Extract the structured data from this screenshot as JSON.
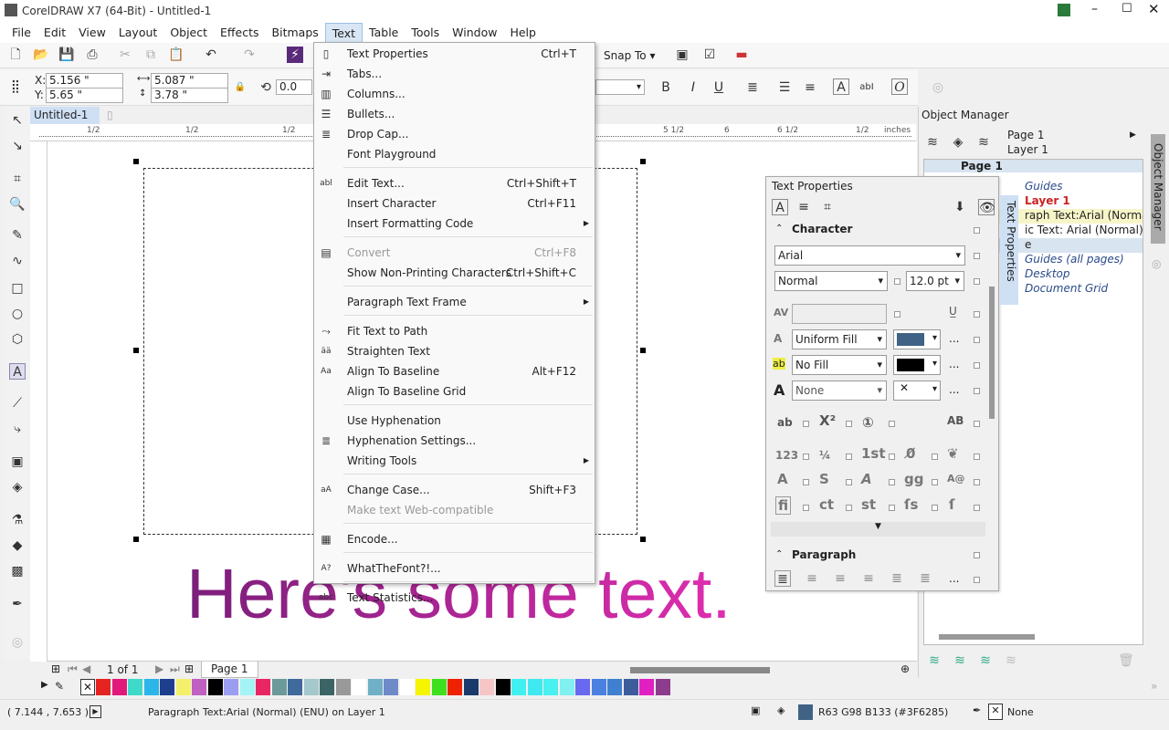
{
  "title": "CorelDRAW X7 (64-Bit) - Untitled-1",
  "menu": [
    "File",
    "Edit",
    "View",
    "Layout",
    "Object",
    "Effects",
    "Bitmaps",
    "Text",
    "Table",
    "Tools",
    "Window",
    "Help"
  ],
  "menu_active": "Text",
  "toolbar": {
    "snap_to": "Snap To"
  },
  "propbar": {
    "x": "5.156 \"",
    "y": "5.65 \"",
    "x_label": "X:",
    "y_label": "Y:",
    "width": "5.087 \"",
    "height": "3.78 \"",
    "rotation": "0.0"
  },
  "document_tab": "Untitled-1",
  "ruler_units": "inches",
  "ruler_labels": [
    "1/2",
    "1/2",
    "1/2",
    "5 1/2",
    "6",
    "6 1/2",
    "1/2"
  ],
  "canvas_text": "Here's some text.",
  "text_menu": [
    {
      "label": "Text Properties",
      "shortcut": "Ctrl+T",
      "icon": "▯"
    },
    {
      "label": "Tabs...",
      "icon": "⇥"
    },
    {
      "label": "Columns...",
      "icon": "▥"
    },
    {
      "label": "Bullets...",
      "icon": "☰"
    },
    {
      "label": "Drop Cap...",
      "icon": "≣"
    },
    {
      "label": "Font Playground"
    },
    {
      "sep": true
    },
    {
      "label": "Edit Text...",
      "shortcut": "Ctrl+Shift+T",
      "icon": "abl"
    },
    {
      "label": "Insert Character",
      "shortcut": "Ctrl+F11"
    },
    {
      "label": "Insert Formatting Code",
      "submenu": true
    },
    {
      "sep": true
    },
    {
      "label": "Convert",
      "shortcut": "Ctrl+F8",
      "disabled": true,
      "icon": "▤"
    },
    {
      "label": "Show Non-Printing Characters",
      "shortcut": "Ctrl+Shift+C"
    },
    {
      "sep": true
    },
    {
      "label": "Paragraph Text Frame",
      "submenu": true
    },
    {
      "sep": true
    },
    {
      "label": "Fit Text to Path",
      "icon": "⤳"
    },
    {
      "label": "Straighten Text",
      "icon": "ää"
    },
    {
      "label": "Align To Baseline",
      "shortcut": "Alt+F12",
      "icon": "Aa"
    },
    {
      "label": "Align To Baseline Grid"
    },
    {
      "sep": true
    },
    {
      "label": "Use Hyphenation"
    },
    {
      "label": "Hyphenation Settings...",
      "icon": "≣"
    },
    {
      "label": "Writing Tools",
      "submenu": true
    },
    {
      "sep": true
    },
    {
      "label": "Change Case...",
      "shortcut": "Shift+F3",
      "icon": "aA"
    },
    {
      "label": "Make text Web-compatible",
      "disabled": true
    },
    {
      "sep": true
    },
    {
      "label": "Encode...",
      "icon": "▦"
    },
    {
      "sep": true
    },
    {
      "label": "WhatTheFont?!...",
      "icon": "A?"
    },
    {
      "sep": true
    },
    {
      "label": "Text Statistics...",
      "icon": "abc"
    }
  ],
  "object_manager": {
    "title": "Object Manager",
    "page": "Page 1",
    "layer": "Layer 1",
    "tree": [
      {
        "label": "Page 1",
        "style": "page"
      },
      {
        "label": "Guides",
        "style": "italic"
      },
      {
        "label": "Layer 1",
        "style": "layer"
      },
      {
        "label": "raph Text:Arial (Normal)",
        "style": "selected"
      },
      {
        "label": "ic Text: Arial (Normal) (EN",
        "style": "normal"
      },
      {
        "label": "e",
        "style": "master"
      },
      {
        "label": "Guides (all pages)",
        "style": "italic"
      },
      {
        "label": "Desktop",
        "style": "italic"
      },
      {
        "label": "Document Grid",
        "style": "italic"
      }
    ]
  },
  "side_tabs": [
    "Object Manager",
    "Text Properties"
  ],
  "text_properties": {
    "title": "Text Properties",
    "character": "Character",
    "font": "Arial",
    "style": "Normal",
    "size": "12.0 pt",
    "fill_type": "Uniform Fill",
    "fill_color": "#3F6285",
    "bg_fill": "No Fill",
    "bg_color": "#000000",
    "outline": "None",
    "paragraph": "Paragraph",
    "more": "..."
  },
  "nav": {
    "page_count": "1 of 1",
    "page_tab": "Page 1"
  },
  "palette": [
    "#e52421",
    "#e0197a",
    "#3ed9c9",
    "#2cb5e8",
    "#1d3f8e",
    "#f5f06b",
    "#c060c0",
    "#000000",
    "#9b9ef0",
    "#a4f4f6",
    "#e82664",
    "#6c9a9a",
    "#3f6a9c",
    "#a4c8cc",
    "#3c6464",
    "#999999",
    "#ffffff",
    "#6fb0c7",
    "#6f8ac8",
    "#ffffff",
    "#f5f500",
    "#3ee01e",
    "#ee2200",
    "#1a3a6c",
    "#f6c6c6",
    "#000000",
    "#40f0f0",
    "#40e8f0",
    "#48f0f0",
    "#80f0f0",
    "#6868f0",
    "#4a80e0",
    "#4080d0",
    "#3c5c9c",
    "#e020c0",
    "#8c3c8c"
  ],
  "status": {
    "coords": "( 7.144 , 7.653 )",
    "info": "Paragraph Text:Arial (Normal) (ENU) on Layer 1",
    "fill": "R63 G98 B133 (#3F6285)",
    "outline": "None"
  }
}
